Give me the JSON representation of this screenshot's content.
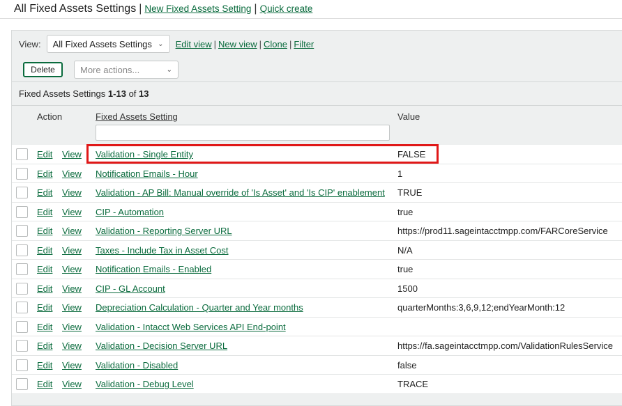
{
  "header": {
    "title": "All Fixed Assets Settings",
    "separator": "|",
    "new_link": "New Fixed Assets Setting",
    "quick_create": "Quick create"
  },
  "viewbar": {
    "label": "View:",
    "selected_view": "All Fixed Assets Settings",
    "links": [
      "Edit view",
      "New view",
      "Clone",
      "Filter"
    ],
    "separator": "|"
  },
  "actions": {
    "delete_label": "Delete",
    "more_actions_placeholder": "More actions..."
  },
  "list": {
    "title": "Fixed Assets Settings",
    "range": "1-13",
    "of_word": "of",
    "total": "13"
  },
  "table": {
    "columns": {
      "action": "Action",
      "setting": "Fixed Assets Setting",
      "value": "Value"
    },
    "edit_label": "Edit",
    "view_label": "View",
    "rows": [
      {
        "setting": "Validation - Single Entity",
        "value": "FALSE"
      },
      {
        "setting": "Notification Emails - Hour",
        "value": "1"
      },
      {
        "setting": "Validation - AP Bill: Manual override of 'Is Asset' and 'Is CIP' enablement",
        "value": "TRUE"
      },
      {
        "setting": "CIP - Automation",
        "value": "true"
      },
      {
        "setting": "Validation - Reporting Server URL",
        "value": "https://prod11.sageintacctmpp.com/FARCoreService"
      },
      {
        "setting": "Taxes - Include Tax in Asset Cost",
        "value": "N/A"
      },
      {
        "setting": "Notification Emails - Enabled",
        "value": "true"
      },
      {
        "setting": "CIP - GL Account",
        "value": "1500"
      },
      {
        "setting": "Depreciation Calculation - Quarter and Year months",
        "value": "quarterMonths:3,6,9,12;endYearMonth:12"
      },
      {
        "setting": "Validation - Intacct Web Services API End-point",
        "value": ""
      },
      {
        "setting": "Validation - Decision Server URL",
        "value": "https://fa.sageintacctmpp.com/ValidationRulesService"
      },
      {
        "setting": "Validation - Disabled",
        "value": "false"
      },
      {
        "setting": "Validation - Debug Level",
        "value": "TRACE"
      }
    ]
  },
  "colors": {
    "link": "#0a6b3d",
    "highlight": "#e01818",
    "panel": "#eef0f0"
  },
  "icons": {
    "dropdown": "chevron-down-icon"
  }
}
